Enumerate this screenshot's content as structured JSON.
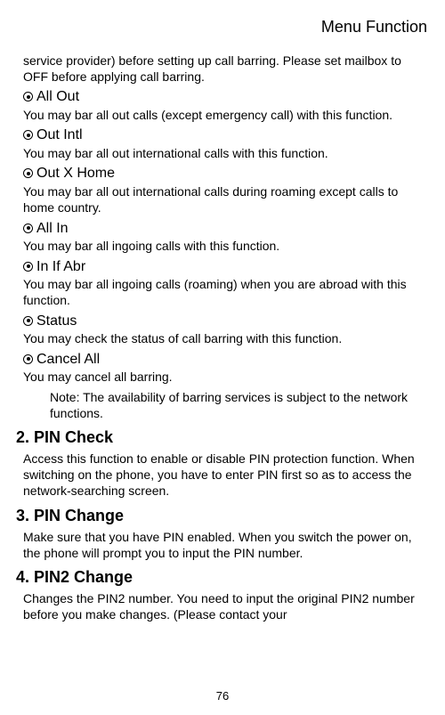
{
  "header": "Menu Function",
  "intro": "service provider) before setting up call barring. Please set mailbox to OFF before applying call barring.",
  "items": [
    {
      "title": "All Out",
      "desc": "You may bar all out calls (except emergency call) with this function."
    },
    {
      "title": "Out Intl",
      "desc": "You may bar all out international calls with this function."
    },
    {
      "title": "Out X Home",
      "desc": "You may bar all out international calls during roaming except calls to home country."
    },
    {
      "title": "All In",
      "desc": "You may bar all ingoing calls with this function."
    },
    {
      "title": "In If Abr",
      "desc": "You may bar all ingoing calls (roaming) when you are abroad with this function."
    },
    {
      "title": "Status",
      "desc": "You may check the status of call barring with this function."
    },
    {
      "title": "Cancel All",
      "desc": "You may cancel all barring."
    }
  ],
  "note": "Note: The availability of barring services is subject to the network functions.",
  "sections": [
    {
      "heading": "2. PIN Check",
      "body": "Access this function to enable or disable PIN protection function. When switching on the phone, you have to enter PIN first so as to access the network-searching screen."
    },
    {
      "heading": "3. PIN Change",
      "body": "Make sure that you have PIN enabled.    When you switch the power on, the phone will prompt you to input the PIN number."
    },
    {
      "heading": "4. PIN2 Change",
      "body": "Changes the PIN2 number. You need to input the original PIN2 number before you make changes. (Please contact your"
    }
  ],
  "page_number": "76"
}
